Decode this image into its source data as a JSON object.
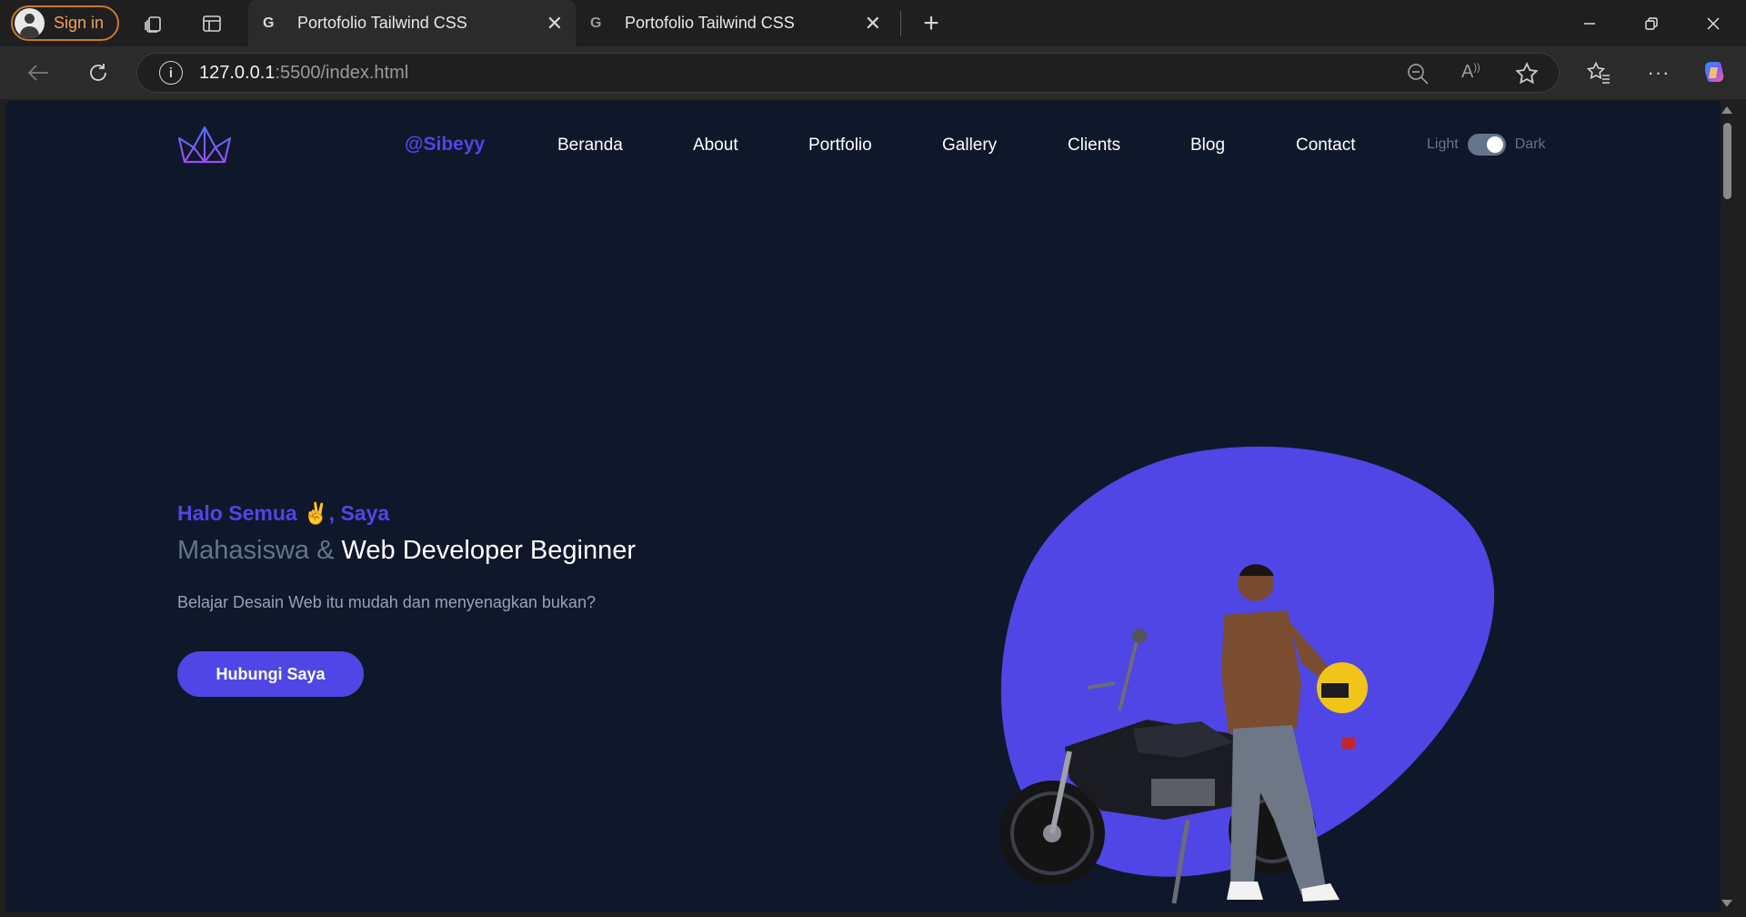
{
  "browser": {
    "signin_label": "Sign in",
    "tabs": [
      {
        "favicon": "G",
        "title": "Portofolio Tailwind CSS",
        "active": true
      },
      {
        "favicon": "G",
        "title": "Portofolio Tailwind CSS",
        "active": false
      }
    ],
    "url_host": "127.0.0.1",
    "url_rest": ":5500/index.html",
    "icons": [
      "workspaces-icon",
      "tab-actions-icon",
      "new-tab-icon",
      "minimize-icon",
      "restore-icon",
      "close-window-icon",
      "back-icon",
      "refresh-icon",
      "site-info-icon",
      "zoom-out-icon",
      "read-aloud-icon",
      "favorite-star-icon",
      "favorites-icon",
      "more-icon",
      "copilot-icon"
    ]
  },
  "nav": {
    "brand": "@Sibeyy",
    "links": [
      "Beranda",
      "About",
      "Portfolio",
      "Gallery",
      "Clients",
      "Blog",
      "Contact"
    ],
    "toggle_light": "Light",
    "toggle_dark": "Dark",
    "accent": "#4f46e5"
  },
  "hero": {
    "greeting": "Halo Semua ✌️, Saya",
    "role_prefix": "Mahasiswa &",
    "role_main": "Web Developer Beginner",
    "tagline": "Belajar Desain Web itu mudah dan menyenagkan bukan?",
    "cta": "Hubungi Saya"
  },
  "colors": {
    "page_bg": "#0f172a",
    "primary": "#4f46e5",
    "muted": "#64748b"
  }
}
